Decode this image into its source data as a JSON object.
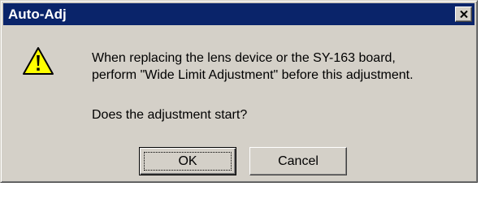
{
  "window": {
    "title": "Auto-Adj",
    "close_icon": "close-icon"
  },
  "message": {
    "icon": "warning-icon",
    "line1": "When replacing the lens device or the SY-163 board,",
    "line2": "perform \"Wide Limit Adjustment\" before this adjustment.",
    "question": "Does the adjustment start?"
  },
  "buttons": {
    "ok_label": "OK",
    "cancel_label": "Cancel"
  },
  "colors": {
    "titlebar": "#0a246a",
    "dialog_face": "#d4d0c8",
    "warning_yellow": "#ffff00"
  }
}
